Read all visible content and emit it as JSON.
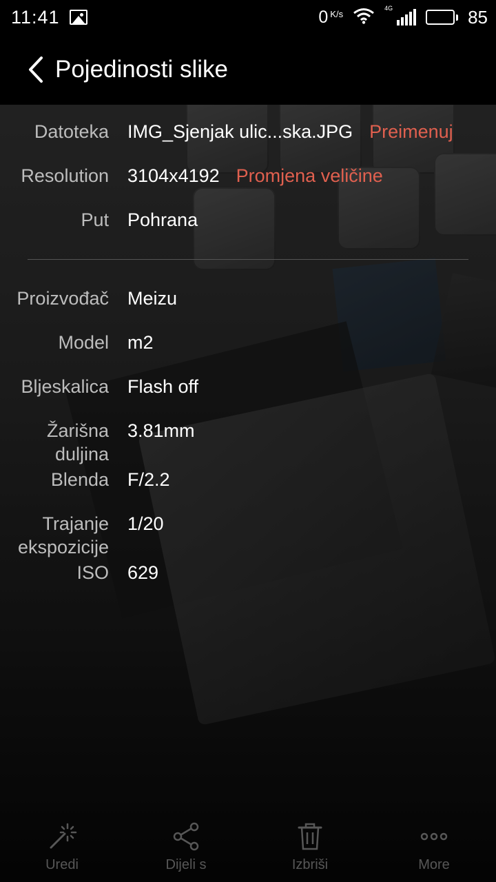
{
  "status_bar": {
    "time": "11:41",
    "net_speed": "0",
    "net_unit": "K/s",
    "network_type": "4G",
    "battery": "85",
    "battery_level": 0.85
  },
  "header": {
    "title": "Pojedinosti slike"
  },
  "details": {
    "file": {
      "label": "Datoteka",
      "value": "IMG_Sjenjak ulic...ska.JPG",
      "action": "Preimenuj"
    },
    "resolution": {
      "label": "Resolution",
      "value": "3104x4192",
      "action": "Promjena veličine"
    },
    "path": {
      "label": "Put",
      "value": "Pohrana"
    },
    "manufacturer": {
      "label": "Proizvođač",
      "value": "Meizu"
    },
    "model": {
      "label": "Model",
      "value": "m2"
    },
    "flash": {
      "label": "Bljeskalica",
      "value": "Flash off"
    },
    "focal_length": {
      "label_line1": "Žarišna",
      "label_line2": "duljina",
      "value": "3.81mm"
    },
    "aperture": {
      "label": "Blenda",
      "value": "F/2.2"
    },
    "exposure": {
      "label_line1": "Trajanje",
      "label_line2": "ekspozicije",
      "value": "1/20"
    },
    "iso": {
      "label": "ISO",
      "value": "629"
    }
  },
  "toolbar": {
    "edit": "Uredi",
    "share": "Dijeli s",
    "delete": "Izbriši",
    "more": "More"
  },
  "colors": {
    "accent": "#e0604f",
    "label": "#bdbdbd"
  }
}
